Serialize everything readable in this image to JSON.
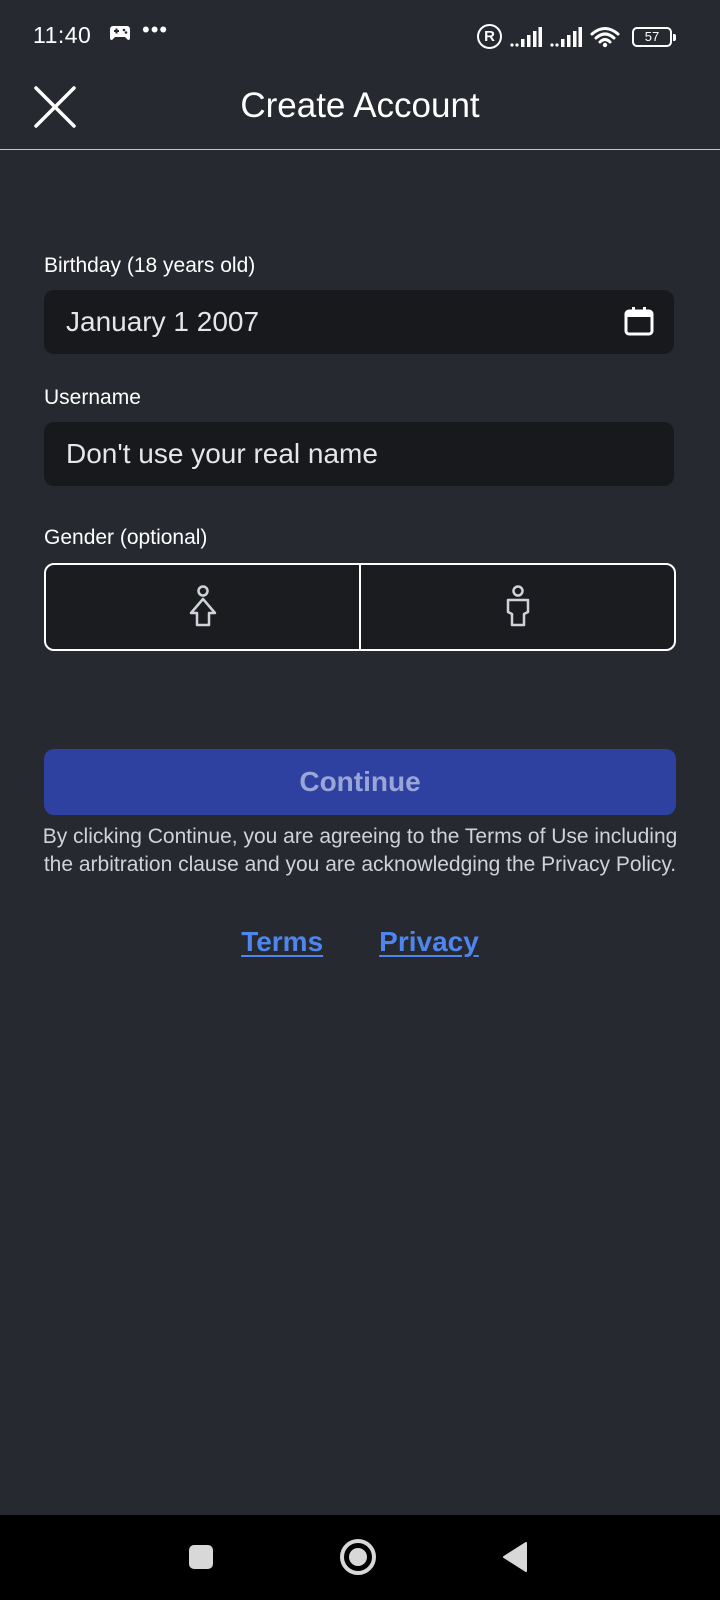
{
  "status_bar": {
    "time": "11:40",
    "dots": "•••",
    "registered": "R",
    "battery": "57"
  },
  "header": {
    "title": "Create Account"
  },
  "form": {
    "birthday_label": "Birthday (18 years old)",
    "birthday_value": "January 1 2007",
    "username_label": "Username",
    "username_placeholder": "Don't use your real name",
    "gender_label": "Gender (optional)"
  },
  "continue_label": "Continue",
  "disclaimer": "By clicking Continue, you are agreeing to the Terms of Use including the arbitration clause and you are acknowledging the Privacy Policy.",
  "links": {
    "terms": "Terms",
    "privacy": "Privacy"
  },
  "colors": {
    "background": "#272930",
    "input_bg": "#18191c",
    "button": "#2e41a0",
    "link": "#4f85ef"
  },
  "icons": {
    "close": "close-icon",
    "calendar": "calendar-icon",
    "female": "female-icon",
    "male": "male-icon"
  }
}
